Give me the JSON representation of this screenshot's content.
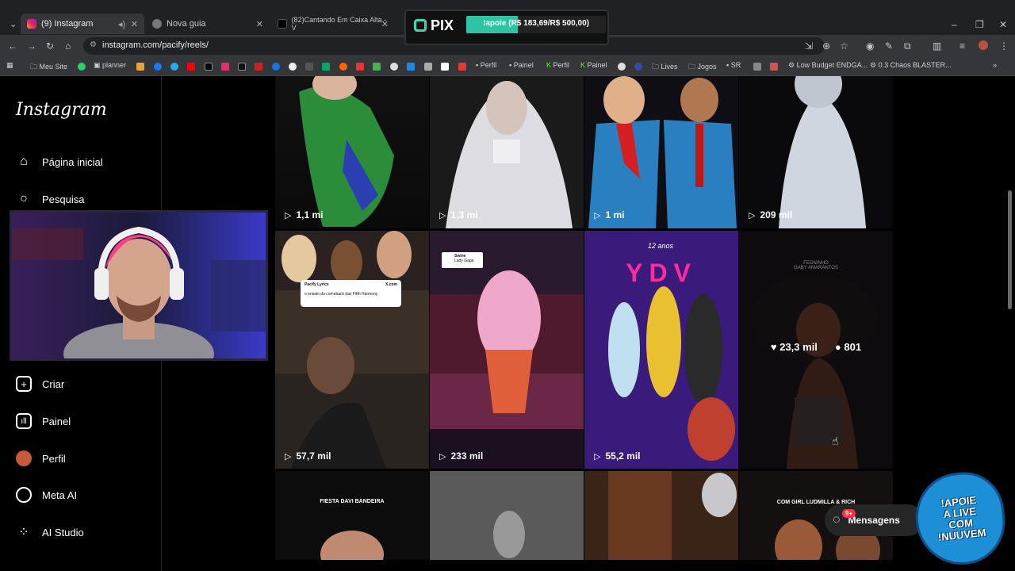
{
  "browser": {
    "tabs": [
      {
        "label": "(9) Instagram"
      },
      {
        "label": "Nova guia"
      },
      {
        "label": "(82)Cantando Em Caixa Alta - V"
      }
    ],
    "url": "instagram.com/pacify/reels/",
    "bookmarks": [
      "Meu Site",
      "planner",
      "Perfil",
      "Painel",
      "Perfil",
      "Painel",
      "Lives",
      "Jogos",
      "SR",
      "Low Budget ENDGA...",
      "0.3 Chaos BLASTER..."
    ]
  },
  "pix_overlay": {
    "logo": "PIX",
    "progress_text": "!apoie (R$ 183,69/R$ 500,00)",
    "progress": 0.367
  },
  "sidebar": {
    "logo": "Instagram",
    "items": [
      {
        "label": "Página inicial",
        "icon": "home-icon"
      },
      {
        "label": "Pesquisa",
        "icon": "search-icon"
      },
      {
        "label": "Criar",
        "icon": "plus-square-icon"
      },
      {
        "label": "Painel",
        "icon": "dashboard-icon"
      },
      {
        "label": "Perfil",
        "icon": "avatar-icon"
      },
      {
        "label": "Meta AI",
        "icon": "meta-ai-ring-icon"
      },
      {
        "label": "AI Studio",
        "icon": "ai-studio-icon"
      }
    ]
  },
  "reels": [
    {
      "views": "1,1 mi",
      "color": "#2b8c3a"
    },
    {
      "views": "1,3 mi",
      "color": "#c9c9cf"
    },
    {
      "views": "1 mi",
      "color": "#1f6fa8"
    },
    {
      "views": "209 mil",
      "color": "#3a3a40"
    },
    {
      "views": "57,7 mil",
      "color": "#5a4a3e"
    },
    {
      "views": "233 mil",
      "color": "#8a2f5a"
    },
    {
      "views": "55,2 mil",
      "color": "#4a2a8c"
    },
    {
      "likes": "23,3 mil",
      "comments": "801",
      "color": "#1e1a1c"
    },
    {
      "caption": "FIESTA DAVI BANDEIRA",
      "color": "#111"
    },
    {
      "caption": "",
      "color": "#4a4a4a"
    },
    {
      "caption": "",
      "color": "#3a2418"
    },
    {
      "caption": "COM GIRL LUDMILLA & RICH",
      "color": "#1a1414"
    }
  ],
  "messages": {
    "label": "Mensagens",
    "badge": "9+"
  },
  "apoie_badge": {
    "line1": "!APOIE",
    "line2": "A LIVE",
    "line3": "COM",
    "line4": "!NUUVEM"
  },
  "tile_texts": {
    "tweet": "o ensaio do comeback das Fifth Harmony",
    "tweet_user": "Pacify Lyrics",
    "xcom": "X.com",
    "swine": "Swine",
    "swine_artist": "Lady Gaga",
    "ydv": "YDV",
    "anos": "12 anos",
    "negrinho": "FEGNINHO",
    "gaby": "GABY AMARANTOS"
  }
}
